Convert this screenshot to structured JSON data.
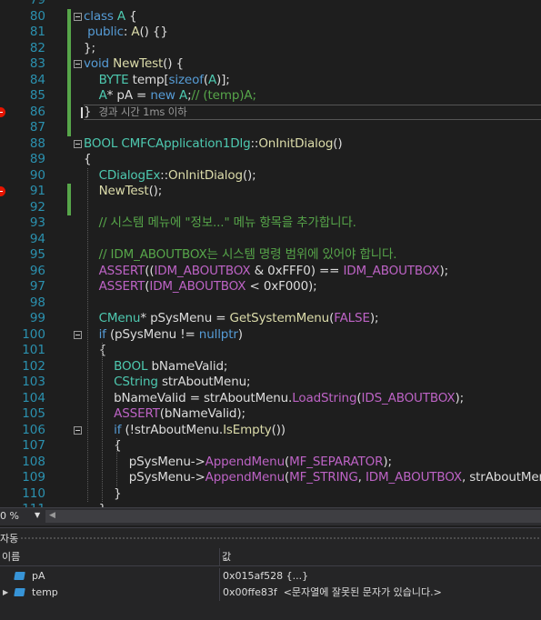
{
  "editor": {
    "lines": [
      {
        "num": "79",
        "tokens": []
      },
      {
        "num": "80",
        "tokens": [
          {
            "t": "class",
            "c": "kw"
          },
          {
            "t": " ",
            "c": "plain"
          },
          {
            "t": "A",
            "c": "type"
          },
          {
            "t": " {",
            "c": "plain"
          }
        ]
      },
      {
        "num": "81",
        "tokens": [
          {
            "t": " ",
            "c": "plain"
          },
          {
            "t": "public",
            "c": "kw"
          },
          {
            "t": ": ",
            "c": "plain"
          },
          {
            "t": "A",
            "c": "fn"
          },
          {
            "t": "() {}",
            "c": "plain"
          }
        ]
      },
      {
        "num": "82",
        "tokens": [
          {
            "t": "};",
            "c": "plain"
          }
        ]
      },
      {
        "num": "83",
        "tokens": [
          {
            "t": "void",
            "c": "kw"
          },
          {
            "t": " ",
            "c": "plain"
          },
          {
            "t": "NewTest",
            "c": "fn"
          },
          {
            "t": "() {",
            "c": "plain"
          }
        ]
      },
      {
        "num": "84",
        "tokens": [
          {
            "t": "    ",
            "c": "plain"
          },
          {
            "t": "BYTE",
            "c": "type"
          },
          {
            "t": " temp[",
            "c": "plain"
          },
          {
            "t": "sizeof",
            "c": "kw"
          },
          {
            "t": "(",
            "c": "plain"
          },
          {
            "t": "A",
            "c": "type"
          },
          {
            "t": ")];",
            "c": "plain"
          }
        ]
      },
      {
        "num": "85",
        "tokens": [
          {
            "t": "    ",
            "c": "plain"
          },
          {
            "t": "A",
            "c": "type"
          },
          {
            "t": "* pA = ",
            "c": "plain"
          },
          {
            "t": "new",
            "c": "kw"
          },
          {
            "t": " ",
            "c": "plain"
          },
          {
            "t": "A",
            "c": "type"
          },
          {
            "t": ";",
            "c": "plain"
          },
          {
            "t": "// (temp)A;",
            "c": "comment"
          }
        ]
      },
      {
        "num": "86",
        "tokens": [
          {
            "t": "}",
            "c": "plain"
          }
        ],
        "hint": "경과 시간 1ms 이하"
      },
      {
        "num": "87",
        "tokens": []
      },
      {
        "num": "88",
        "tokens": [
          {
            "t": "BOOL",
            "c": "type"
          },
          {
            "t": " ",
            "c": "plain"
          },
          {
            "t": "CMFCApplication1Dlg",
            "c": "type"
          },
          {
            "t": "::",
            "c": "plain"
          },
          {
            "t": "OnInitDialog",
            "c": "fn"
          },
          {
            "t": "()",
            "c": "plain"
          }
        ]
      },
      {
        "num": "89",
        "tokens": [
          {
            "t": "{",
            "c": "plain"
          }
        ]
      },
      {
        "num": "90",
        "tokens": [
          {
            "t": "    ",
            "c": "plain"
          },
          {
            "t": "CDialogEx",
            "c": "type"
          },
          {
            "t": "::",
            "c": "plain"
          },
          {
            "t": "OnInitDialog",
            "c": "fn"
          },
          {
            "t": "();",
            "c": "plain"
          }
        ]
      },
      {
        "num": "91",
        "tokens": [
          {
            "t": "    ",
            "c": "plain"
          },
          {
            "t": "NewTest",
            "c": "fn"
          },
          {
            "t": "();",
            "c": "plain"
          }
        ]
      },
      {
        "num": "92",
        "tokens": []
      },
      {
        "num": "93",
        "tokens": [
          {
            "t": "    ",
            "c": "plain"
          },
          {
            "t": "// 시스템 메뉴에 \"정보...\" 메뉴 항목을 추가합니다.",
            "c": "comment"
          }
        ]
      },
      {
        "num": "94",
        "tokens": []
      },
      {
        "num": "95",
        "tokens": [
          {
            "t": "    ",
            "c": "plain"
          },
          {
            "t": "// IDM_ABOUTBOX는 시스템 명령 범위에 있어야 합니다.",
            "c": "comment"
          }
        ]
      },
      {
        "num": "96",
        "tokens": [
          {
            "t": "    ",
            "c": "plain"
          },
          {
            "t": "ASSERT",
            "c": "macro"
          },
          {
            "t": "((",
            "c": "plain"
          },
          {
            "t": "IDM_ABOUTBOX",
            "c": "macro"
          },
          {
            "t": " & 0xFFF0) == ",
            "c": "plain"
          },
          {
            "t": "IDM_ABOUTBOX",
            "c": "macro"
          },
          {
            "t": ");",
            "c": "plain"
          }
        ]
      },
      {
        "num": "97",
        "tokens": [
          {
            "t": "    ",
            "c": "plain"
          },
          {
            "t": "ASSERT",
            "c": "macro"
          },
          {
            "t": "(",
            "c": "plain"
          },
          {
            "t": "IDM_ABOUTBOX",
            "c": "macro"
          },
          {
            "t": " < 0xF000);",
            "c": "plain"
          }
        ]
      },
      {
        "num": "98",
        "tokens": []
      },
      {
        "num": "99",
        "tokens": [
          {
            "t": "    ",
            "c": "plain"
          },
          {
            "t": "CMenu",
            "c": "type"
          },
          {
            "t": "* pSysMenu = ",
            "c": "plain"
          },
          {
            "t": "GetSystemMenu",
            "c": "fn"
          },
          {
            "t": "(",
            "c": "plain"
          },
          {
            "t": "FALSE",
            "c": "macro"
          },
          {
            "t": ");",
            "c": "plain"
          }
        ]
      },
      {
        "num": "100",
        "tokens": [
          {
            "t": "    ",
            "c": "plain"
          },
          {
            "t": "if",
            "c": "kw"
          },
          {
            "t": " (pSysMenu != ",
            "c": "plain"
          },
          {
            "t": "nullptr",
            "c": "kw"
          },
          {
            "t": ")",
            "c": "plain"
          }
        ]
      },
      {
        "num": "101",
        "tokens": [
          {
            "t": "    {",
            "c": "plain"
          }
        ]
      },
      {
        "num": "102",
        "tokens": [
          {
            "t": "        ",
            "c": "plain"
          },
          {
            "t": "BOOL",
            "c": "type"
          },
          {
            "t": " bNameValid;",
            "c": "plain"
          }
        ]
      },
      {
        "num": "103",
        "tokens": [
          {
            "t": "        ",
            "c": "plain"
          },
          {
            "t": "CString",
            "c": "type"
          },
          {
            "t": " strAboutMenu;",
            "c": "plain"
          }
        ]
      },
      {
        "num": "104",
        "tokens": [
          {
            "t": "        bNameValid = strAboutMenu.",
            "c": "plain"
          },
          {
            "t": "LoadString",
            "c": "macro"
          },
          {
            "t": "(",
            "c": "plain"
          },
          {
            "t": "IDS_ABOUTBOX",
            "c": "macro"
          },
          {
            "t": ");",
            "c": "plain"
          }
        ]
      },
      {
        "num": "105",
        "tokens": [
          {
            "t": "        ",
            "c": "plain"
          },
          {
            "t": "ASSERT",
            "c": "macro"
          },
          {
            "t": "(bNameValid);",
            "c": "plain"
          }
        ]
      },
      {
        "num": "106",
        "tokens": [
          {
            "t": "        ",
            "c": "plain"
          },
          {
            "t": "if",
            "c": "kw"
          },
          {
            "t": " (!strAboutMenu.",
            "c": "plain"
          },
          {
            "t": "IsEmpty",
            "c": "fn"
          },
          {
            "t": "())",
            "c": "plain"
          }
        ]
      },
      {
        "num": "107",
        "tokens": [
          {
            "t": "        {",
            "c": "plain"
          }
        ]
      },
      {
        "num": "108",
        "tokens": [
          {
            "t": "            pSysMenu->",
            "c": "plain"
          },
          {
            "t": "AppendMenu",
            "c": "macro"
          },
          {
            "t": "(",
            "c": "plain"
          },
          {
            "t": "MF_SEPARATOR",
            "c": "macro"
          },
          {
            "t": ");",
            "c": "plain"
          }
        ]
      },
      {
        "num": "109",
        "tokens": [
          {
            "t": "            pSysMenu->",
            "c": "plain"
          },
          {
            "t": "AppendMenu",
            "c": "macro"
          },
          {
            "t": "(",
            "c": "plain"
          },
          {
            "t": "MF_STRING",
            "c": "macro"
          },
          {
            "t": ", ",
            "c": "plain"
          },
          {
            "t": "IDM_ABOUTBOX",
            "c": "macro"
          },
          {
            "t": ", strAboutMenu);",
            "c": "plain"
          }
        ]
      },
      {
        "num": "110",
        "tokens": [
          {
            "t": "        }",
            "c": "plain"
          }
        ]
      },
      {
        "num": "111",
        "tokens": [
          {
            "t": "    }",
            "c": "plain"
          }
        ]
      }
    ],
    "breakpoint_lines": [
      "86",
      "91"
    ]
  },
  "statusbar": {
    "zoom": "0 %"
  },
  "watch_panel": {
    "title": "자동",
    "columns": {
      "name": "이름",
      "value": "값"
    },
    "rows": [
      {
        "name": "pA",
        "value": "0x015af528 {...}",
        "expandable": false
      },
      {
        "name": "temp",
        "value": "0x00ffe83f  <문자열에 잘못된 문자가 있습니다.>",
        "expandable": true
      }
    ]
  }
}
